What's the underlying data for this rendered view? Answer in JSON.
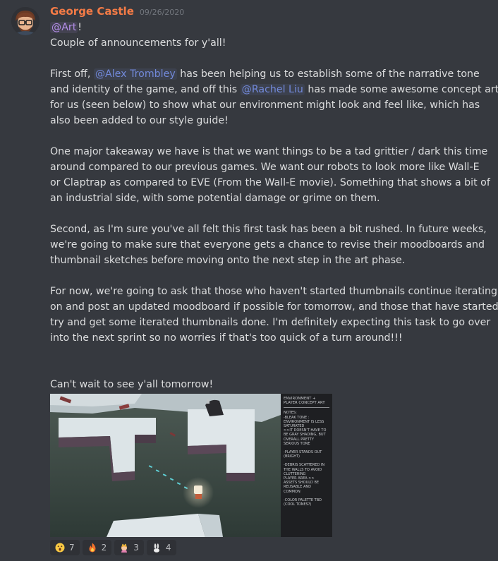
{
  "message": {
    "author": "George Castle",
    "timestamp": "09/26/2020",
    "role_mention": "@Art",
    "line1_after_mention": "!",
    "line2": "Couple of announcements for y'all!",
    "p1": {
      "a": "First off, ",
      "mention1": "@Alex Trombley",
      "b": " has been helping us to establish some of the narrative tone",
      "c": "and identity of the game, and off this ",
      "mention2": "@Rachel Liu",
      "d": " has made some awesome concept art",
      "e": "for us (seen below) to show what our environment might look and feel like, which has",
      "f": "also been added to our style guide!"
    },
    "p2": [
      "One major takeaway we have is that we want things to be a tad grittier / dark this time",
      "around compared to our previous games. We want our robots to look more like Wall-E",
      "or Claptrap as compared to EVE (From the Wall-E movie). Something that shows a bit of",
      "an industrial side, with some potential damage or grime on them."
    ],
    "p3": [
      "Second, as I'm sure you've all felt this first task has been a bit rushed. In future weeks,",
      "we're going to make sure that everyone gets a chance to revise their moodboards and",
      "thumbnail sketches before moving onto the next step in the art phase."
    ],
    "p4": [
      "For now, we're going to ask that those who haven't started thumbnails continue iterating",
      "on and post an updated moodboard if possible for tomorrow, and those that have started",
      "try and get some iterated thumbnails done. I'm definitely expecting this task to go over",
      "into the next sprint so no worries if that's too quick of a turn around!!!"
    ],
    "closing": "Can't wait to see y'all tomorrow!"
  },
  "attachment": {
    "header": "ENVIRONMENT +\nPLAYER CONCEPT ART",
    "notes": [
      "NOTES:\n-BLEAK TONE :\nENVIRONMENT IS LESS\nSATURATED\n>>IT DOESN'T HAVE TO\nBE GRAY SHADING, BUT\nOVERALL PRETTY\nSERIOUS TONE",
      "-PLAYER STANDS OUT\n(BRIGHT)",
      "-DEBRIS SCATTERED IN\nTHE WALLS TO AVOID\nCLUTTERING\nPLAYER AREA >>\nASSETS SHOULD BE\nREUSABLE AND\nCOMMON",
      "-COLOR PALETTE TBD\n(COOL TONES?)"
    ]
  },
  "reactions": [
    {
      "emoji": "astonished-face-icon",
      "count": "7"
    },
    {
      "emoji": "fire-icon",
      "count": "2"
    },
    {
      "emoji": "princess-icon",
      "count": "3"
    },
    {
      "emoji": "rabbit-icon",
      "count": "4"
    }
  ],
  "colors": {
    "background": "#36393f",
    "username": "#f47b46",
    "mention": "#7289da",
    "role_mention": "#b48ee8",
    "text": "#dcddde"
  }
}
